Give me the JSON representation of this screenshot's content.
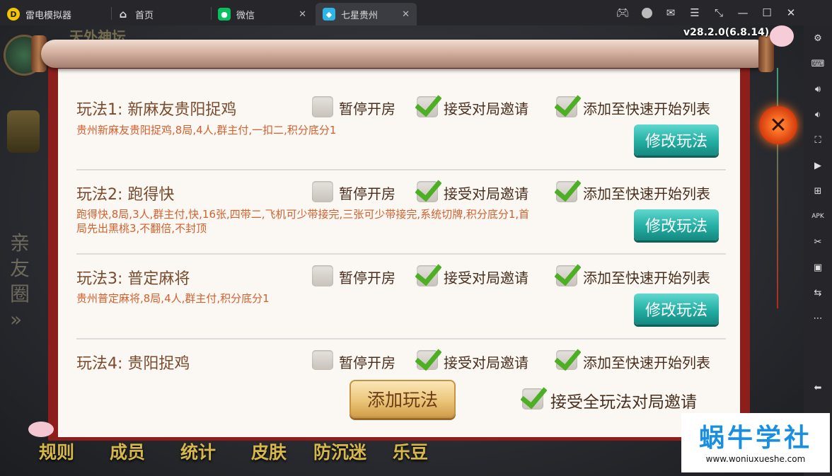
{
  "app": {
    "tabs": [
      {
        "label": "雷电模拟器",
        "icon": "leidian-logo-icon"
      },
      {
        "label": "首页",
        "icon": "home-icon"
      },
      {
        "label": "微信",
        "icon": "wechat-icon"
      },
      {
        "label": "七星贵州",
        "icon": "game-app-icon"
      }
    ]
  },
  "game": {
    "version": "v28.2.0(6.8.14)",
    "bg_top_text": "天外神坛",
    "side_text": [
      "亲",
      "友",
      "圈",
      "»"
    ],
    "bottom_nav": [
      "规则",
      "成员",
      "统计",
      "皮肤",
      "防沉迷",
      "乐豆"
    ]
  },
  "dialog": {
    "rows": [
      {
        "title": "玩法1:  新麻友贵阳捉鸡",
        "desc": "贵州新麻友贵阳捉鸡,8局,4人,群主付,一扣二,积分底分1",
        "pause": false,
        "accept": true,
        "quick": true
      },
      {
        "title": "玩法2:  跑得快",
        "desc": "跑得快,8局,3人,群主付,快,16张,四带二,飞机可少带接完,三张可少带接完,系统切牌,积分底分1,首局先出黑桃3,不翻倍,不封顶",
        "pause": false,
        "accept": true,
        "quick": true
      },
      {
        "title": "玩法3:  普定麻将",
        "desc": "贵州普定麻将,8局,4人,群主付,积分底分1",
        "pause": false,
        "accept": true,
        "quick": true
      },
      {
        "title": "玩法4:  贵阳捉鸡",
        "desc": "",
        "pause": false,
        "accept": true,
        "quick": true
      }
    ],
    "pause_label": "暂停开房",
    "accept_label": "接受对局邀请",
    "quick_label": "添加至快速开始列表",
    "modify_label": "修改玩法",
    "add_label": "添加玩法",
    "accept_all_label": "接受全玩法对局邀请",
    "accept_all": true
  },
  "watermark": {
    "title": "蜗牛学社",
    "url": "www.woniuxueshe.com"
  },
  "colors": {
    "frame_red": "#8c1f1c",
    "teal": "#23aea3",
    "gold": "#ebc57a",
    "desc_orange": "#d2602e",
    "check_green": "#4db024"
  }
}
